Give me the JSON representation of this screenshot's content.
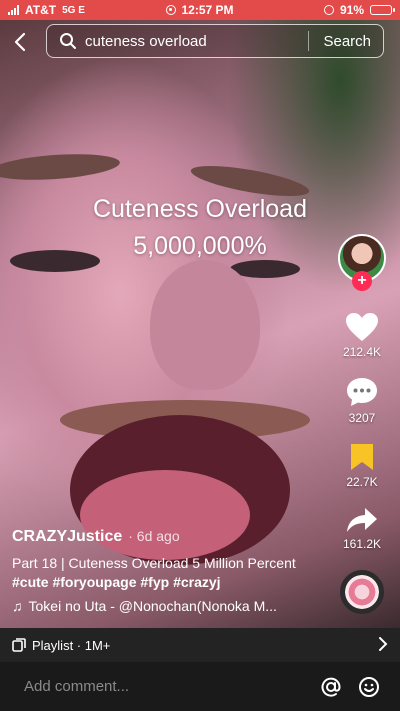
{
  "status_bar": {
    "carrier": "AT&T",
    "network": "5G E",
    "time": "12:57 PM",
    "battery": "91%",
    "battery_level": 0.91
  },
  "search": {
    "query": "cuteness overload",
    "button_label": "Search"
  },
  "video_overlay": {
    "title": "Cuteness Overload",
    "subtitle": "5,000,000%"
  },
  "actions": {
    "likes": "212.4K",
    "comments": "3207",
    "saves": "22.7K",
    "shares": "161.2K"
  },
  "caption": {
    "author": "CRAZYJustice",
    "time_ago": "· 6d ago",
    "description_prefix": "Part 18 | Cuteness Overload 5 Million Percent",
    "hashtags": [
      "#cute",
      "#foryoupage",
      "#fyp",
      "#crazyj"
    ],
    "sound": "Tokei no Uta - @Nonochan(Nonoka M..."
  },
  "playlist": {
    "label": "Playlist · 1M+"
  },
  "comment_bar": {
    "placeholder": "Add comment..."
  },
  "colors": {
    "status_bar": "#e34a4a",
    "like": "#ffffff",
    "saved": "#f7c325",
    "follow": "#fe2c55"
  }
}
